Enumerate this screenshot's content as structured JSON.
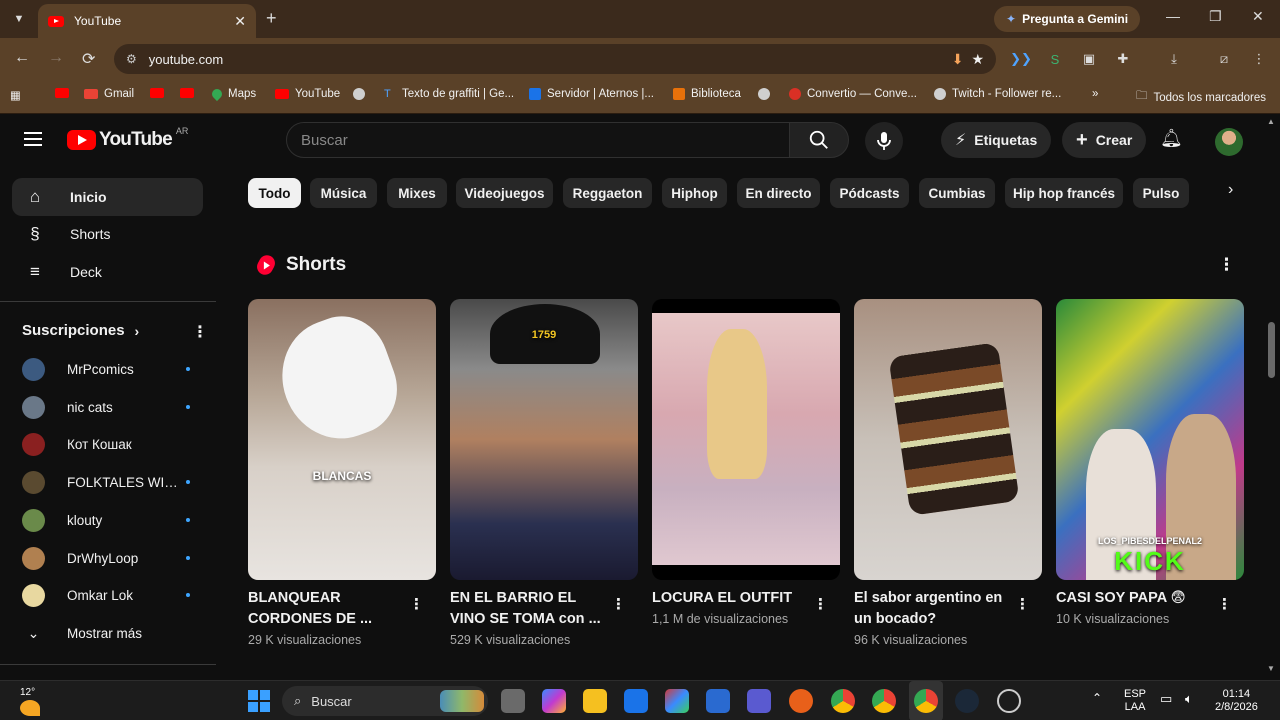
{
  "browser": {
    "tab_title": "YouTube",
    "new_tab": "+",
    "gemini_label": "Pregunta a Gemini",
    "url": "youtube.com",
    "bookmarks": [
      {
        "label": "",
        "icon": "youtube-icon"
      },
      {
        "label": "Gmail",
        "icon": "gmail-icon"
      },
      {
        "label": "",
        "icon": "youtube-icon"
      },
      {
        "label": "",
        "icon": "youtube-icon"
      },
      {
        "label": "Maps",
        "icon": "maps-icon"
      },
      {
        "label": "YouTube",
        "icon": "youtube-icon"
      },
      {
        "label": "",
        "icon": "globe-icon"
      },
      {
        "label": "Texto de graffiti | Ge...",
        "icon": "text-icon"
      },
      {
        "label": "Servidor | Aternos |...",
        "icon": "aternos-icon"
      },
      {
        "label": "Biblioteca",
        "icon": "library-icon"
      },
      {
        "label": "",
        "icon": "globe-icon"
      },
      {
        "label": "Convertio — Conve...",
        "icon": "convertio-icon"
      },
      {
        "label": "Twitch - Follower re...",
        "icon": "globe-icon"
      }
    ],
    "bookmarks_more": "»",
    "all_bookmarks": "Todos los marcadores"
  },
  "youtube": {
    "logo_text": "YouTube",
    "logo_region": "AR",
    "search_placeholder": "Buscar",
    "tags_button": "Etiquetas",
    "create_button": "Crear",
    "sidebar": {
      "main": [
        {
          "label": "Inicio",
          "icon": "home-icon",
          "active": true
        },
        {
          "label": "Shorts",
          "icon": "shorts-icon",
          "active": false
        },
        {
          "label": "Deck",
          "icon": "deck-icon",
          "active": false
        }
      ],
      "subs_heading": "Suscripciones",
      "subscriptions": [
        {
          "name": "MrPcomics",
          "color": "#3c5a80",
          "new": true
        },
        {
          "name": "nic cats",
          "color": "#6a7888",
          "new": true
        },
        {
          "name": "Кот Кошак",
          "color": "#8a2020",
          "new": false
        },
        {
          "name": "FOLKTALES WIT...",
          "color": "#5a4a30",
          "new": true
        },
        {
          "name": "klouty",
          "color": "#6a8a4a",
          "new": true
        },
        {
          "name": "DrWhyLoop",
          "color": "#b08050",
          "new": true
        },
        {
          "name": "Omkar Lok",
          "color": "#e8d8a0",
          "new": true
        }
      ],
      "show_more": "Mostrar más"
    },
    "chips": [
      "Todo",
      "Música",
      "Mixes",
      "Videojuegos",
      "Reggaeton",
      "Hiphop",
      "En directo",
      "Pódcasts",
      "Cumbias",
      "Hip hop francés",
      "Pulso"
    ],
    "shelf_title": "Shorts",
    "shorts": [
      {
        "title": "BLANQUEAR CORDONES DE ...",
        "views": "29 K visualizaciones",
        "overlay": "BLANCAS"
      },
      {
        "title": "EN EL BARRIO EL VINO SE TOMA con ...",
        "views": "529 K visualizaciones",
        "overlay": "1759"
      },
      {
        "title": "LOCURA EL OUTFIT",
        "views": "1,1 M de visualizaciones",
        "overlay": ""
      },
      {
        "title": "El sabor argentino en un bocado?",
        "views": "96 K visualizaciones",
        "overlay": ""
      },
      {
        "title": "CASI SOY PAPA 😨",
        "views": "10 K visualizaciones",
        "overlay": "KICK",
        "overlay_small": "LOS_PIBESDELPENAL2"
      }
    ]
  },
  "taskbar": {
    "temperature": "12°",
    "search_label": "Buscar",
    "lang_top": "ESP",
    "lang_bottom": "LAA",
    "time": "01:14",
    "date": "2/8/2026"
  }
}
